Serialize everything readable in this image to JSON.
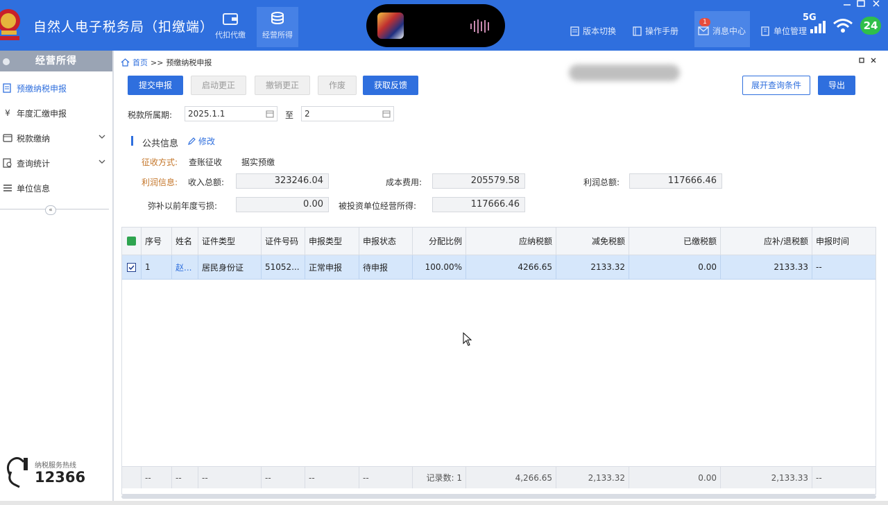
{
  "app": {
    "title": "自然人电子税务局（扣缴端）"
  },
  "topnav": [
    {
      "label": "代扣代缴",
      "icon": "wallet-icon"
    },
    {
      "label": "经营所得",
      "icon": "coins-icon"
    }
  ],
  "toolbar_right": {
    "version_switch": "版本切换",
    "manual": "操作手册",
    "messages": "消息中心",
    "messages_count": "1",
    "unit_management": "单位管理"
  },
  "status_bar": {
    "network": "5G",
    "battery": "24"
  },
  "sidebar": {
    "header": "经营所得",
    "items": [
      {
        "label": "预缴纳税申报",
        "icon": "declare-icon"
      },
      {
        "label": "年度汇缴申报",
        "icon": "yuan-icon"
      },
      {
        "label": "税款缴纳",
        "icon": "pay-icon"
      },
      {
        "label": "查询统计",
        "icon": "query-icon"
      },
      {
        "label": "单位信息",
        "icon": "list-icon"
      }
    ],
    "collapse": "«",
    "hotline_label": "纳税服务热线",
    "hotline_number": "12366"
  },
  "breadcrumb": {
    "home": "首页",
    "sep": ">>",
    "current": "预缴纳税申报"
  },
  "buttons": {
    "submit": "提交申报",
    "start_correction": "启动更正",
    "cancel_correction": "撤销更正",
    "void": "作废",
    "get_feedback": "获取反馈",
    "expand_query": "展开查询条件",
    "export": "导出"
  },
  "period": {
    "label": "税款所属期:",
    "start": "2025.1.1",
    "to": "至",
    "end": "2"
  },
  "public_info": {
    "title": "公共信息",
    "edit": "修改",
    "collection_label": "征收方式:",
    "collection_value": "查账征收",
    "prepay_value": "据实预缴",
    "profit_label": "利润信息:",
    "income_label": "收入总额:",
    "income_value": "323246.04",
    "cost_label": "成本费用:",
    "cost_value": "205579.58",
    "profit_total_label": "利润总额:",
    "profit_total_value": "117666.46",
    "loss_label": "弥补以前年度亏损:",
    "loss_value": "0.00",
    "invest_label": "被投资单位经营所得:",
    "invest_value": "117666.46"
  },
  "table": {
    "headers": [
      "序号",
      "姓名",
      "证件类型",
      "证件号码",
      "申报类型",
      "申报状态",
      "分配比例",
      "应纳税额",
      "减免税额",
      "已缴税额",
      "应补/退税额",
      "申报时间"
    ],
    "rows": [
      [
        "1",
        "赵...",
        "居民身份证",
        "51052...",
        "正常申报",
        "待申报",
        "100.00%",
        "4266.65",
        "2133.32",
        "0.00",
        "2133.33",
        "--"
      ]
    ],
    "footer": [
      "--",
      "--",
      "--",
      "--",
      "--",
      "--",
      "记录数: 1",
      "4,266.65",
      "2,133.32",
      "0.00",
      "2,133.33",
      "--"
    ]
  },
  "colors": {
    "brand": "#2f6fde",
    "sidebar_header": "#9aa4b4",
    "selected_row": "#d6e7fb",
    "label_orange": "#c4762a"
  }
}
